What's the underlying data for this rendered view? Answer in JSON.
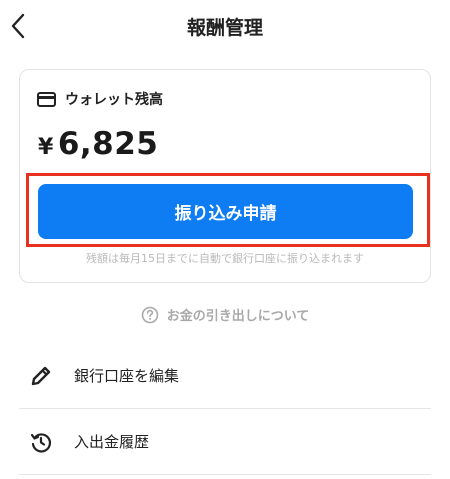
{
  "header": {
    "title": "報酬管理",
    "back_icon": "chevron-left-icon"
  },
  "wallet": {
    "icon": "credit-card-icon",
    "label": "ウォレット残高",
    "currency_symbol": "¥",
    "balance": "6,825"
  },
  "transfer_button": {
    "label": "振り込み申請"
  },
  "notice": "残額は毎月15日までに自動で銀行口座に振り込まれます",
  "help_link": {
    "icon": "question-circle-icon",
    "label": "お金の引き出しについて"
  },
  "menu": [
    {
      "icon": "pencil-icon",
      "label": "銀行口座を編集"
    },
    {
      "icon": "history-icon",
      "label": "入出金履歴"
    }
  ],
  "colors": {
    "accent": "#0e7cf2",
    "highlight": "#e8321f"
  }
}
